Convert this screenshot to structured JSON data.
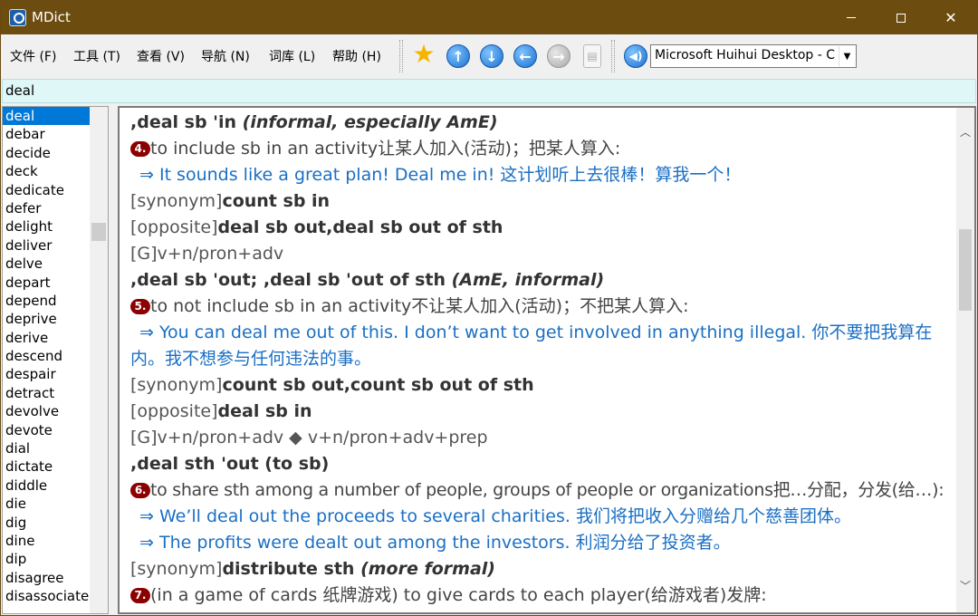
{
  "window": {
    "title": "MDict"
  },
  "menu": [
    {
      "label": "文件 (F)"
    },
    {
      "label": "工具 (T)"
    },
    {
      "label": "查看 (V)"
    },
    {
      "label": "导航 (N)"
    },
    {
      "label": "词库 (L)"
    },
    {
      "label": "帮助 (H)"
    }
  ],
  "toolbar": {
    "icons": [
      "favorite-star-icon",
      "up-arrow-icon",
      "down-arrow-icon",
      "back-arrow-icon",
      "forward-arrow-icon",
      "clipboard-icon",
      "speaker-icon"
    ],
    "font_select": "Microsoft Huihui Desktop - C"
  },
  "search": {
    "value": "deal"
  },
  "wordlist": {
    "selected": "deal",
    "items": [
      "deal",
      "debar",
      "decide",
      "deck",
      "dedicate",
      "defer",
      "delight",
      "deliver",
      "delve",
      "depart",
      "depend",
      "deprive",
      "derive",
      "descend",
      "despair",
      "detract",
      "devolve",
      "devote",
      "dial",
      "dictate",
      "diddle",
      "die",
      "dig",
      "dine",
      "dip",
      "disagree",
      "disassociate"
    ]
  },
  "entry": {
    "h1": {
      "main": ",deal sb 'in ",
      "note": "(informal, especially AmE)"
    },
    "s4": {
      "num": "4.",
      "text": "to include sb in an activity让某人加入(活动)；把某人算入:"
    },
    "ex4": "⇒ It sounds like a great plan! Deal me in!   这计划听上去很棒！算我一个！",
    "syn1": {
      "tag": "[synonym]",
      "word": "count sb in"
    },
    "opp1": {
      "tag": "[opposite]",
      "word": "deal sb out,deal sb out of sth"
    },
    "gram1": "[G]v+n/pron+adv",
    "h2": {
      "main": ",deal sb 'out; ,deal sb 'out of sth ",
      "note": "(AmE, informal)"
    },
    "s5": {
      "num": "5.",
      "text": "to not include sb in an activity不让某人加入(活动)；不把某人算入:"
    },
    "ex5a": "⇒ You can deal me out of this. I don’t want to get involved in anything illegal.  你不要把我算在",
    "ex5b": "内。我不想参与任何违法的事。",
    "syn2": {
      "tag": "[synonym]",
      "word": "count sb out,count sb out of sth"
    },
    "opp2": {
      "tag": "[opposite]",
      "word": "deal sb in"
    },
    "gram2": "[G]v+n/pron+adv ◆ v+n/pron+adv+prep",
    "h3": {
      "main": ",deal sth 'out (to sb)"
    },
    "s6": {
      "num": "6.",
      "text": "to share sth among a number of people, groups of people or organizations把…分配，分发(给…):"
    },
    "ex6a": "⇒ We’ll deal out the proceeds to several charities.  我们将把收入分赠给几个慈善团体。",
    "ex6b": "⇒ The profits were dealt out among the investors.  利润分给了投资者。",
    "syn3": {
      "tag": "[synonym]",
      "word": "distribute sth ",
      "note": "(more formal)"
    },
    "s7": {
      "num": "7.",
      "text": "(in a game of cards 纸牌游戏) to give cards to each player(给游戏者)发牌:"
    }
  },
  "colors": {
    "titlebar": "#6d4c10",
    "selection": "#0078d7",
    "example": "#1a6fc4",
    "sense_badge": "#8b0000",
    "search_bg": "#e0f7f7"
  }
}
